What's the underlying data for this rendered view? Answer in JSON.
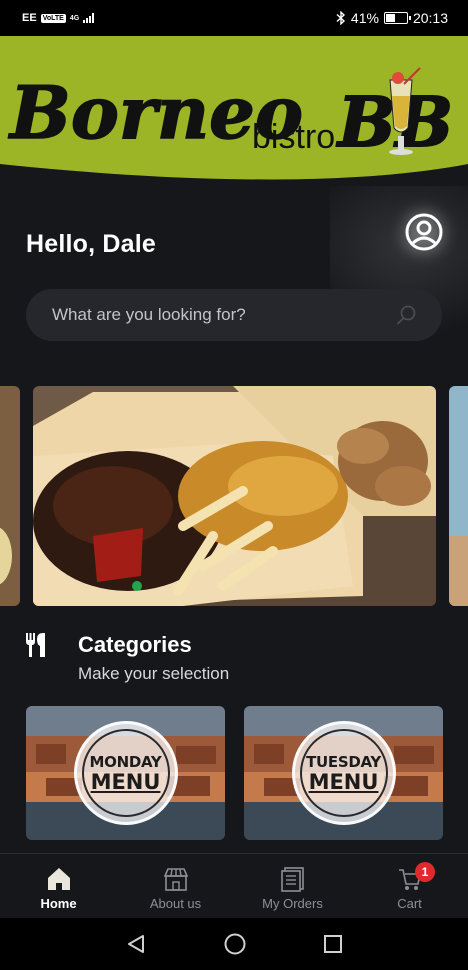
{
  "status_bar": {
    "carrier": "EE",
    "volte": "VoLTE",
    "network": "4G",
    "bluetooth_icon": "bluetooth-icon",
    "battery_percent": "41%",
    "battery_level": 0.41,
    "time": "20:13"
  },
  "header": {
    "logo_text": "Borneo",
    "logo_sub": "bistro",
    "logo_mark": "BB",
    "brand_color": "#9cb527"
  },
  "greeting": "Hello, Dale",
  "search": {
    "placeholder": "What are you looking for?",
    "icon": "search-icon"
  },
  "carousel": {
    "active_index": 0,
    "indicator_color": "#1fa64a"
  },
  "categories": {
    "icon": "cutlery-icon",
    "title": "Categories",
    "subtitle": "Make your selection",
    "items": [
      {
        "line1": "MONDAY",
        "line2": "MENU"
      },
      {
        "line1": "TUESDAY",
        "line2": "MENU"
      }
    ]
  },
  "bottom_nav": {
    "items": [
      {
        "label": "Home",
        "icon": "home-icon",
        "active": true
      },
      {
        "label": "About us",
        "icon": "store-icon",
        "active": false
      },
      {
        "label": "My Orders",
        "icon": "orders-icon",
        "active": false
      },
      {
        "label": "Cart",
        "icon": "cart-icon",
        "active": false,
        "badge": "1"
      }
    ]
  }
}
